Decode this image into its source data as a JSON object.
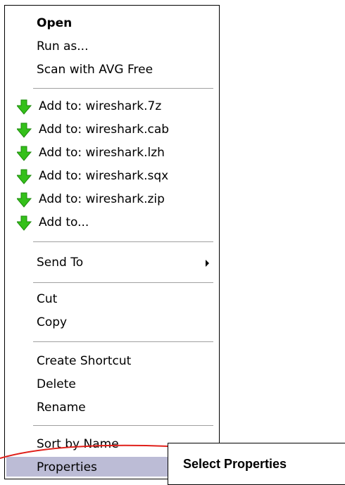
{
  "menu": {
    "items": [
      {
        "label": "Open"
      },
      {
        "label": "Run as..."
      },
      {
        "label": "Scan with AVG Free"
      },
      {
        "label": "Add to: wireshark.7z",
        "icon": "green-down-arrow-icon"
      },
      {
        "label": "Add to: wireshark.cab",
        "icon": "green-down-arrow-icon"
      },
      {
        "label": "Add to: wireshark.lzh",
        "icon": "green-down-arrow-icon"
      },
      {
        "label": "Add to: wireshark.sqx",
        "icon": "green-down-arrow-icon"
      },
      {
        "label": "Add to: wireshark.zip",
        "icon": "green-down-arrow-icon"
      },
      {
        "label": "Add to...",
        "icon": "green-down-arrow-icon"
      },
      {
        "label": "Send To",
        "icon": "submenu-arrow-icon"
      },
      {
        "label": "Cut"
      },
      {
        "label": "Copy"
      },
      {
        "label": "Create Shortcut"
      },
      {
        "label": "Delete"
      },
      {
        "label": "Rename"
      },
      {
        "label": "Sort by Name"
      },
      {
        "label": "Properties"
      }
    ]
  },
  "callout": {
    "text": "Select Properties"
  },
  "colors": {
    "menu_background": "#ffffff",
    "highlight": "#bcbcd6",
    "separator": "#a0a0a0",
    "annotation_line": "#e0201a",
    "arrow_green": "#34c01a"
  }
}
